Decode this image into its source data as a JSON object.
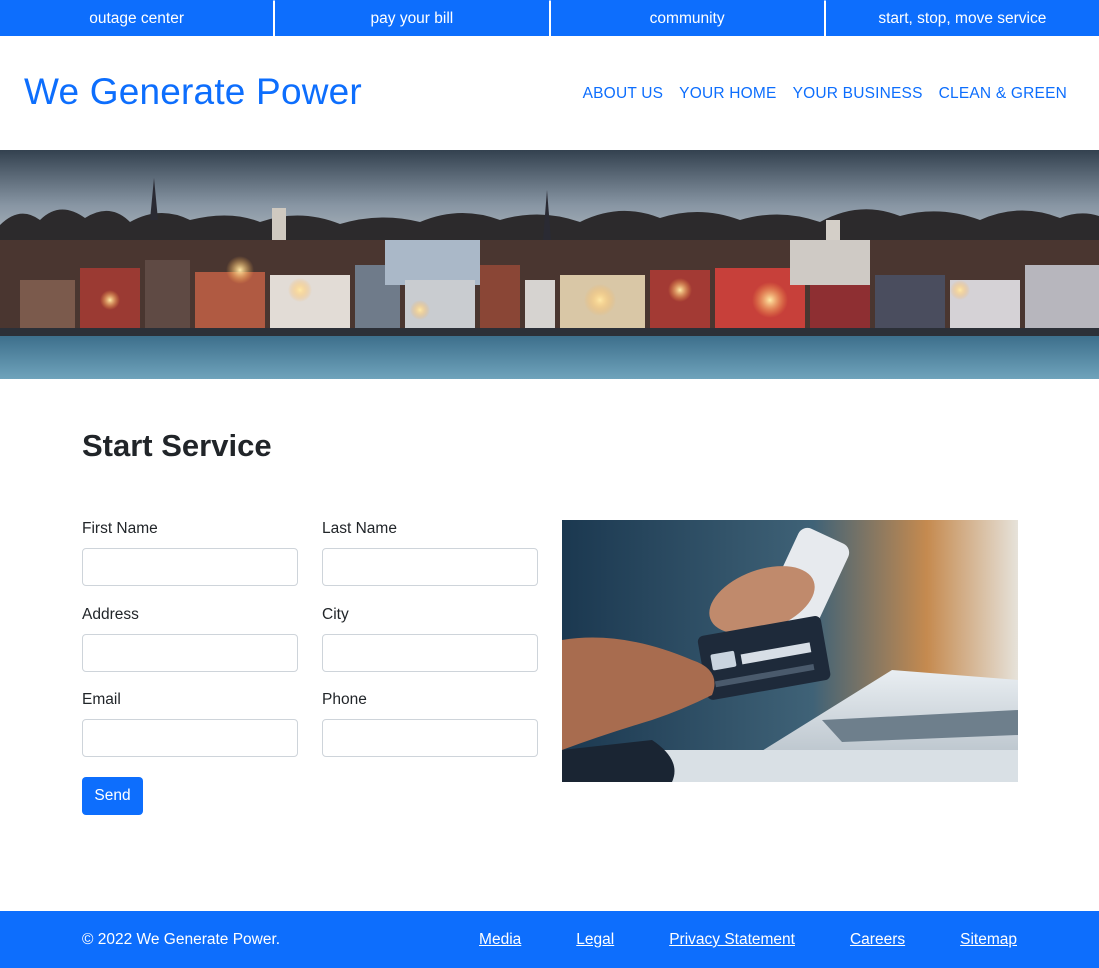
{
  "topbar": {
    "links": [
      "outage center",
      "pay your bill",
      "community",
      "start, stop, move service"
    ]
  },
  "header": {
    "brand": "We Generate Power",
    "nav": [
      "ABOUT US",
      "YOUR HOME",
      "YOUR BUSINESS",
      "CLEAN & GREEN"
    ]
  },
  "main": {
    "title": "Start Service",
    "form": {
      "first_name_label": "First Name",
      "last_name_label": "Last Name",
      "address_label": "Address",
      "city_label": "City",
      "email_label": "Email",
      "phone_label": "Phone",
      "send_label": "Send"
    }
  },
  "footer": {
    "copyright": "© 2022 We Generate Power.",
    "links": [
      "Media",
      "Legal",
      "Privacy Statement",
      "Careers",
      "Sitemap"
    ]
  },
  "colors": {
    "primary": "#0d6efd",
    "text": "#212529",
    "input_border": "#ced4da"
  }
}
